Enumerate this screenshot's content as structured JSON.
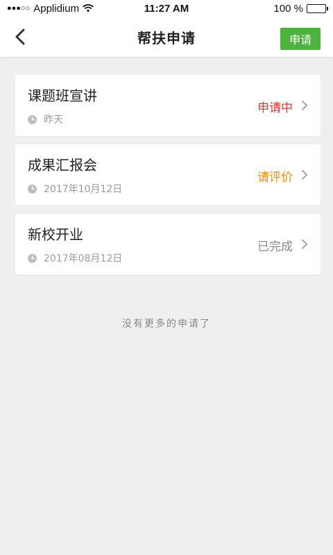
{
  "status_bar": {
    "carrier": "Applidium",
    "time": "11:27 AM",
    "battery": "100 %"
  },
  "nav": {
    "title": "帮扶申请",
    "apply_label": "申请"
  },
  "items": [
    {
      "title": "课题班宣讲",
      "date": "昨天",
      "status": "申请中",
      "status_color": "#e03a2e"
    },
    {
      "title": "成果汇报会",
      "date": "2017年10月12日",
      "status": "请评价",
      "status_color": "#f08c1c"
    },
    {
      "title": "新校开业",
      "date": "2017年08月12日",
      "status": "已完成",
      "status_color": "#8a8a8a"
    }
  ],
  "empty_hint": "没有更多的申请了",
  "colors": {
    "accent": "#4cb43c"
  }
}
